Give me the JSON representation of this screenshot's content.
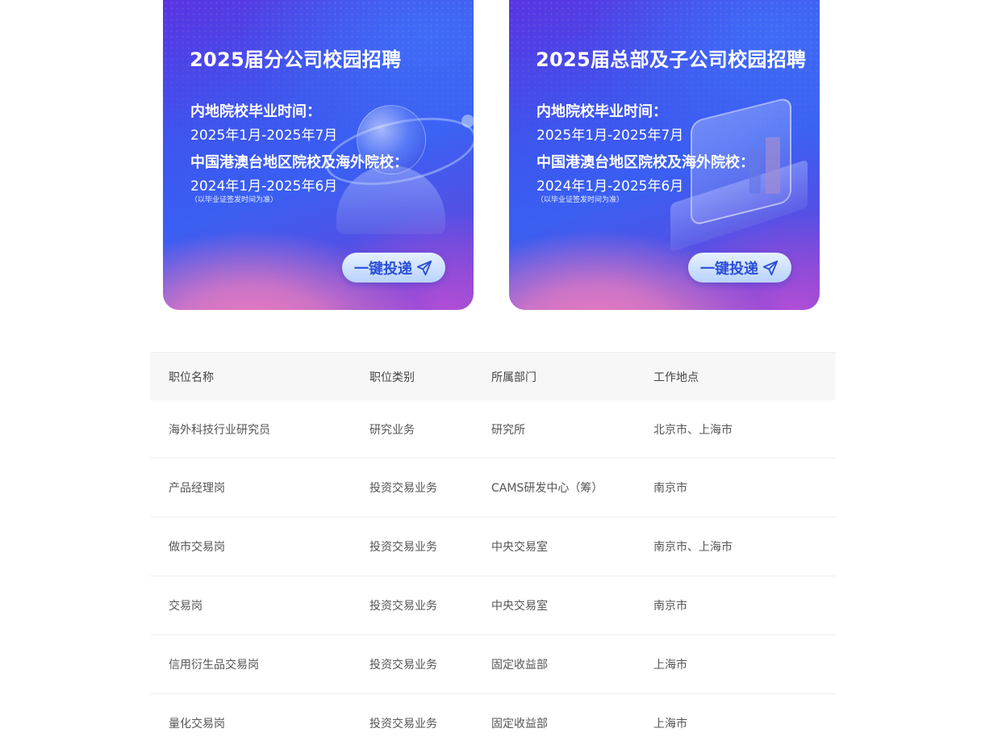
{
  "banners": [
    {
      "title": "2025届分公司校园招聘",
      "mainland_heading": "内地院校毕业时间：",
      "mainland_dates": "2025年1月-2025年7月",
      "overseas_heading": "中国港澳台地区院校及海外院校：",
      "overseas_dates": "2024年1月-2025年6月",
      "note": "（以毕业证签发时间为准）",
      "button_label": "一键投递",
      "button_icon": "paper-plane-icon"
    },
    {
      "title": "2025届总部及子公司校园招聘",
      "mainland_heading": "内地院校毕业时间：",
      "mainland_dates": "2025年1月-2025年7月",
      "overseas_heading": "中国港澳台地区院校及海外院校：",
      "overseas_dates": "2024年1月-2025年6月",
      "note": "（以毕业证签发时间为准）",
      "button_label": "一键投递",
      "button_icon": "paper-plane-icon"
    }
  ],
  "table": {
    "headers": [
      "职位名称",
      "职位类别",
      "所属部门",
      "工作地点"
    ],
    "rows": [
      [
        "海外科技行业研究员",
        "研究业务",
        "研究所",
        "北京市、上海市"
      ],
      [
        "产品经理岗",
        "投资交易业务",
        "CAMS研发中心（筹）",
        "南京市"
      ],
      [
        "做市交易岗",
        "投资交易业务",
        "中央交易室",
        "南京市、上海市"
      ],
      [
        "交易岗",
        "投资交易业务",
        "中央交易室",
        "南京市"
      ],
      [
        "信用衍生品交易岗",
        "投资交易业务",
        "固定收益部",
        "上海市"
      ],
      [
        "量化交易岗",
        "投资交易业务",
        "固定收益部",
        "上海市"
      ]
    ]
  },
  "colors": {
    "button_text": "#2b4fd8",
    "header_bg": "#f7f7f7",
    "row_divider": "#efefef"
  }
}
